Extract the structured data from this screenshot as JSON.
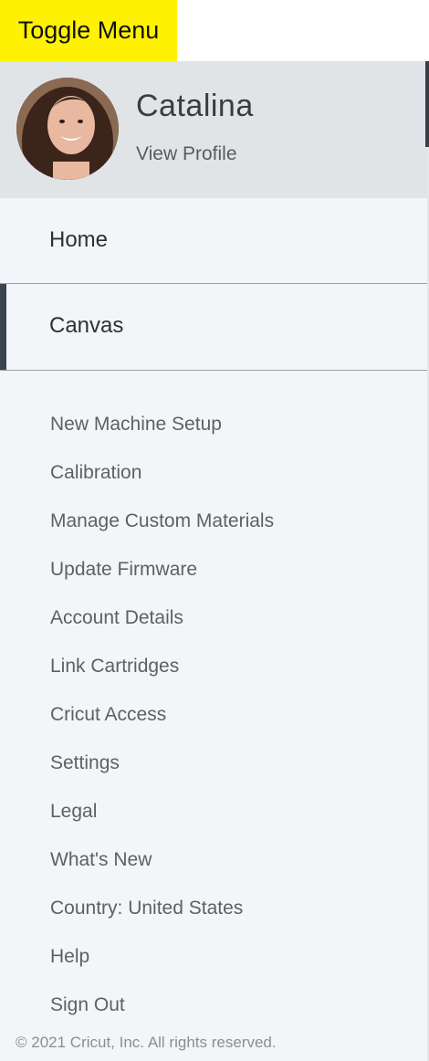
{
  "annotation": {
    "label": "Toggle Menu",
    "color": "#fff200"
  },
  "profile": {
    "name": "Catalina",
    "link": "View Profile"
  },
  "nav": {
    "primary": [
      {
        "label": "Home",
        "active": false
      },
      {
        "label": "Canvas",
        "active": true
      }
    ],
    "secondary": [
      "New Machine Setup",
      "Calibration",
      "Manage Custom Materials",
      "Update Firmware",
      "Account Details",
      "Link Cartridges",
      "Cricut Access",
      "Settings",
      "Legal",
      "What's New",
      "Country: United States",
      "Help",
      "Sign Out"
    ]
  },
  "footer": {
    "copyright": "© 2021 Cricut, Inc. All rights reserved."
  },
  "colors": {
    "menu_background": "#f3f6f9",
    "profile_background": "#e1e4e7",
    "active_indicator": "#3a4350"
  }
}
